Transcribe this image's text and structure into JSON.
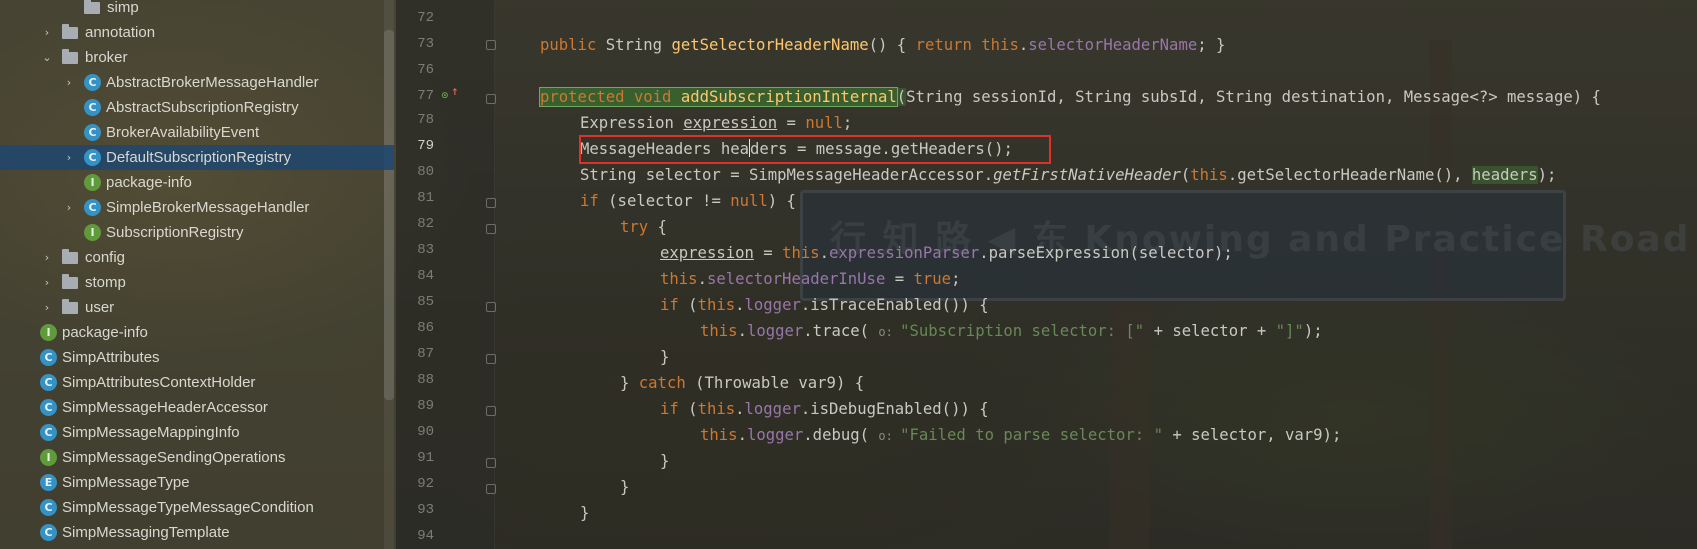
{
  "tree": {
    "items": [
      {
        "chevron": "",
        "icon": "folder",
        "label": "simp",
        "selected": false
      },
      {
        "chevron": "›",
        "icon": "folder",
        "label": "annotation",
        "selected": false
      },
      {
        "chevron": "⌄",
        "icon": "folder",
        "label": "broker",
        "selected": false
      },
      {
        "chevron": "›",
        "icon": "C",
        "label": "AbstractBrokerMessageHandler",
        "selected": false
      },
      {
        "chevron": "",
        "icon": "C",
        "label": "AbstractSubscriptionRegistry",
        "selected": false
      },
      {
        "chevron": "",
        "icon": "C",
        "label": "BrokerAvailabilityEvent",
        "selected": false
      },
      {
        "chevron": "›",
        "icon": "C",
        "label": "DefaultSubscriptionRegistry",
        "selected": true
      },
      {
        "chevron": "",
        "icon": "I",
        "label": "package-info",
        "selected": false
      },
      {
        "chevron": "›",
        "icon": "C",
        "label": "SimpleBrokerMessageHandler",
        "selected": false
      },
      {
        "chevron": "",
        "icon": "I",
        "label": "SubscriptionRegistry",
        "selected": false
      },
      {
        "chevron": "›",
        "icon": "folder",
        "label": "config",
        "selected": false
      },
      {
        "chevron": "›",
        "icon": "folder",
        "label": "stomp",
        "selected": false
      },
      {
        "chevron": "›",
        "icon": "folder",
        "label": "user",
        "selected": false
      },
      {
        "chevron": "",
        "icon": "I",
        "label": "package-info",
        "selected": false
      },
      {
        "chevron": "",
        "icon": "C",
        "label": "SimpAttributes",
        "selected": false
      },
      {
        "chevron": "",
        "icon": "C",
        "label": "SimpAttributesContextHolder",
        "selected": false
      },
      {
        "chevron": "",
        "icon": "C",
        "label": "SimpMessageHeaderAccessor",
        "selected": false
      },
      {
        "chevron": "",
        "icon": "C",
        "label": "SimpMessageMappingInfo",
        "selected": false
      },
      {
        "chevron": "",
        "icon": "I",
        "label": "SimpMessageSendingOperations",
        "selected": false
      },
      {
        "chevron": "",
        "icon": "E",
        "label": "SimpMessageType",
        "selected": false
      },
      {
        "chevron": "",
        "icon": "C",
        "label": "SimpMessageTypeMessageCondition",
        "selected": false
      },
      {
        "chevron": "",
        "icon": "C",
        "label": "SimpMessagingTemplate",
        "selected": false
      }
    ]
  },
  "editor": {
    "line_numbers": [
      "72",
      "73",
      "76",
      "77",
      "78",
      "79",
      "80",
      "81",
      "82",
      "83",
      "84",
      "85",
      "86",
      "87",
      "88",
      "89",
      "90",
      "91",
      "92",
      "93",
      "94"
    ],
    "current_line": "79",
    "code": {
      "l73_a": "public",
      "l73_b": " String ",
      "l73_c": "getSelectorHeaderName",
      "l73_d": "() { ",
      "l73_e": "return this",
      "l73_f": ".",
      "l73_g": "selectorHeaderName",
      "l73_h": "; }",
      "l77_a": "protected void ",
      "l77_b": "addSubscriptionInternal",
      "l77_c": "(",
      "l77_d": "String sessionId, String subsId, String destination, Message<?> message) {",
      "l78_a": "Expression ",
      "l78_b": "expression",
      "l78_c": " = ",
      "l78_d": "null",
      "l78_e": ";",
      "l79_a": "MessageHeaders hea",
      "l79_b": "ders = message.getHeaders();",
      "l80_a": "String selector = SimpMessageHeaderAccessor.",
      "l80_b": "getFirstNativeHeader",
      "l80_c": "(",
      "l80_d": "this",
      "l80_e": ".getSelectorHeaderName(), ",
      "l80_f": "headers",
      "l80_g": ");",
      "l81_a": "if",
      "l81_b": " (selector != ",
      "l81_c": "null",
      "l81_d": ") {",
      "l82_a": "try",
      "l82_b": " {",
      "l83_a": "expression",
      "l83_b": " = ",
      "l83_c": "this",
      "l83_d": ".",
      "l83_e": "expressionParser",
      "l83_f": ".parseExpression(selector);",
      "l84_a": "this",
      "l84_b": ".",
      "l84_c": "selectorHeaderInUse",
      "l84_d": " = ",
      "l84_e": "true",
      "l84_f": ";",
      "l85_a": "if",
      "l85_b": " (",
      "l85_c": "this",
      "l85_d": ".",
      "l85_e": "logger",
      "l85_f": ".isTraceEnabled()) {",
      "l86_a": "this",
      "l86_b": ".",
      "l86_c": "logger",
      "l86_d": ".trace( ",
      "l86_hint": "o: ",
      "l86_e": "\"Subscription selector: [\"",
      "l86_f": " + selector + ",
      "l86_g": "\"]\"",
      "l86_h": ");",
      "l87": "}",
      "l88_a": "} ",
      "l88_b": "catch",
      "l88_c": " (Throwable var9) {",
      "l89_a": "if",
      "l89_b": " (",
      "l89_c": "this",
      "l89_d": ".",
      "l89_e": "logger",
      "l89_f": ".isDebugEnabled()) {",
      "l90_a": "this",
      "l90_b": ".",
      "l90_c": "logger",
      "l90_d": ".debug( ",
      "l90_hint": "o: ",
      "l90_e": "\"Failed to parse selector: \"",
      "l90_f": " + selector, var9);",
      "l91": "}",
      "l92": "}",
      "l93": "}"
    }
  },
  "background": {
    "sign_text": "行  知  路    ◀ 东  Knowing and Practice Road  西 ▶"
  },
  "colors": {
    "keyword": "#cc7832",
    "field": "#9876aa",
    "method": "#ffc66d",
    "string": "#6a8759",
    "highlight_box": "#e0302a",
    "selection": "#1e466e"
  }
}
